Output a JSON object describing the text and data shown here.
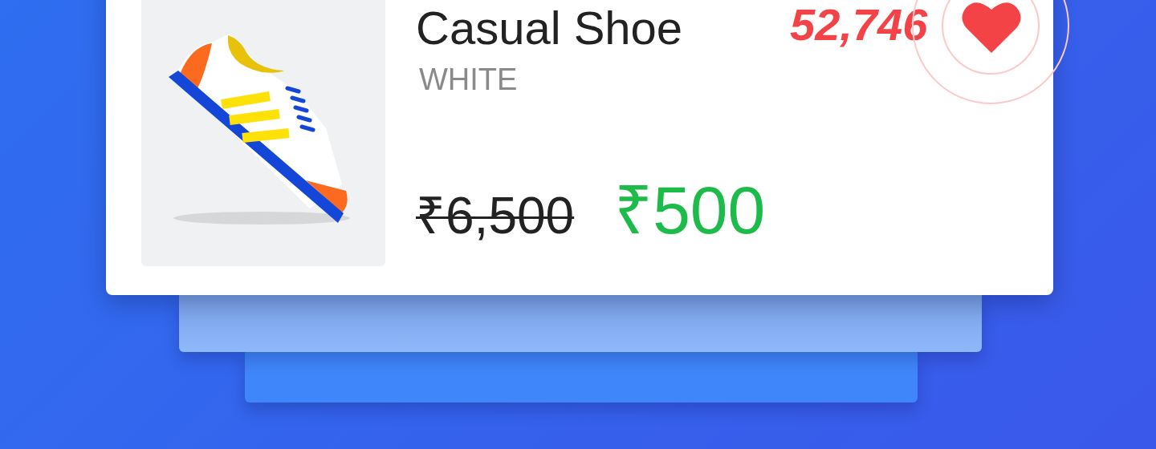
{
  "product": {
    "name": "Casual Shoe",
    "color_name": "WHITE",
    "likes": "52,746",
    "liked": true,
    "old_price": "₹6,500",
    "price": "₹500"
  }
}
